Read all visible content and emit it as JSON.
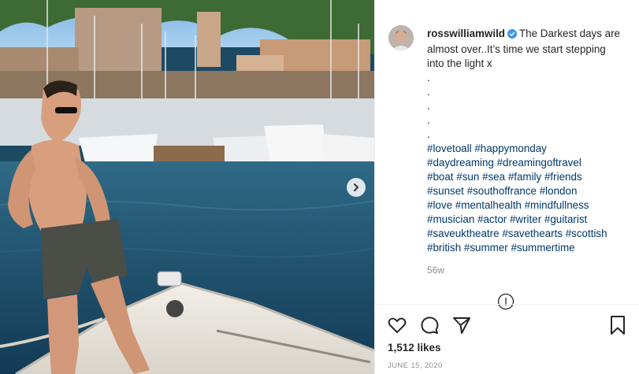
{
  "post": {
    "username": "rosswilliamwild",
    "caption_text": "The Darkest days are almost over..It’s time we start stepping into the light x",
    "dots": [
      ".",
      ".",
      ".",
      ".",
      "."
    ],
    "hashtags": [
      "#lovetoall",
      "#happymonday",
      "#daydreaming",
      "#dreamingoftravel",
      "#boat",
      "#sun",
      "#sea",
      "#family",
      "#friends",
      "#sunset",
      "#southoffrance",
      "#london",
      "#love",
      "#mentalhealth",
      "#mindfullness",
      "#musician",
      "#actor",
      "#writer",
      "#guitarist",
      "#saveuktheatre",
      "#savethearts",
      "#scottish",
      "#british",
      "#summer",
      "#summertime"
    ],
    "time_ago": "56w",
    "likes": "1,512 likes",
    "date": "JUNE 15, 2020"
  },
  "icons": {
    "verified": "verified-badge-icon",
    "next": "chevron-right-icon",
    "more": "more-options-icon",
    "like": "heart-icon",
    "comment": "comment-icon",
    "share": "share-icon",
    "save": "bookmark-icon"
  },
  "colors": {
    "verified": "#3897f0",
    "hashtag": "#00376b",
    "muted": "#8e8e8e"
  }
}
